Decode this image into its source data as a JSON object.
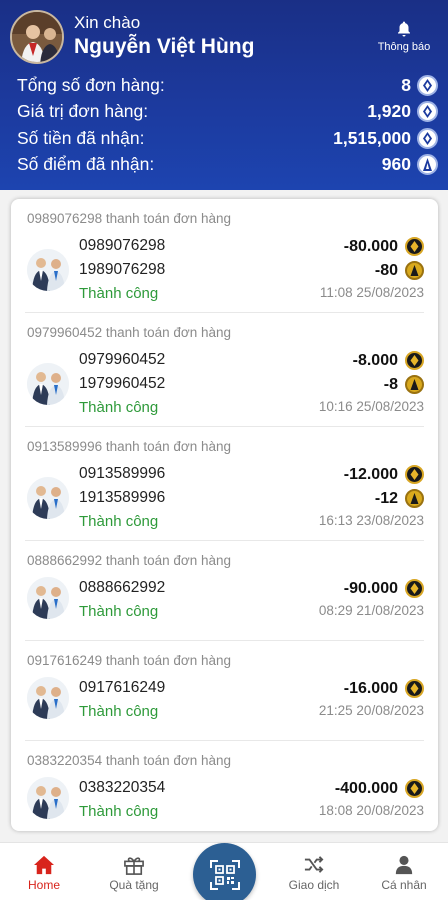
{
  "header": {
    "greeting": "Xin chào",
    "user_name": "Nguyễn Việt Hùng",
    "notification_label": "Thông báo",
    "stats": [
      {
        "label": "Tổng số đơn hàng:",
        "value": "8"
      },
      {
        "label": "Giá trị đơn hàng:",
        "value": "1,920"
      },
      {
        "label": "Số tiền đã nhận:",
        "value": "1,515,000"
      },
      {
        "label": "Số điểm đã nhận:",
        "value": "960"
      }
    ]
  },
  "transactions": [
    {
      "title": "0989076298 thanh toán đơn hàng",
      "line1": "0989076298",
      "line2": "1989076298",
      "status": "Thành công",
      "amount": "-80.000",
      "points": "-80",
      "time": "11:08 25/08/2023"
    },
    {
      "title": "0979960452 thanh toán đơn hàng",
      "line1": "0979960452",
      "line2": "1979960452",
      "status": "Thành công",
      "amount": "-8.000",
      "points": "-8",
      "time": "10:16 25/08/2023"
    },
    {
      "title": "0913589996 thanh toán đơn hàng",
      "line1": "0913589996",
      "line2": "1913589996",
      "status": "Thành công",
      "amount": "-12.000",
      "points": "-12",
      "time": "16:13 23/08/2023"
    },
    {
      "title": "0888662992 thanh toán đơn hàng",
      "line1": "0888662992",
      "line2": "",
      "status": "Thành công",
      "amount": "-90.000",
      "points": "",
      "time": "08:29 21/08/2023"
    },
    {
      "title": "0917616249 thanh toán đơn hàng",
      "line1": "0917616249",
      "line2": "",
      "status": "Thành công",
      "amount": "-16.000",
      "points": "",
      "time": "21:25 20/08/2023"
    },
    {
      "title": "0383220354 thanh toán đơn hàng",
      "line1": "0383220354",
      "line2": "",
      "status": "Thành công",
      "amount": "-400.000",
      "points": "",
      "time": "18:08 20/08/2023"
    }
  ],
  "nav": {
    "home": "Home",
    "gifts": "Quà tặng",
    "transactions": "Giao dịch",
    "profile": "Cá nhân"
  },
  "colors": {
    "header_blue": "#1c3a9e",
    "success_green": "#2e9a3a",
    "active_red": "#d8241c",
    "qr_blue": "#2c5f93"
  }
}
